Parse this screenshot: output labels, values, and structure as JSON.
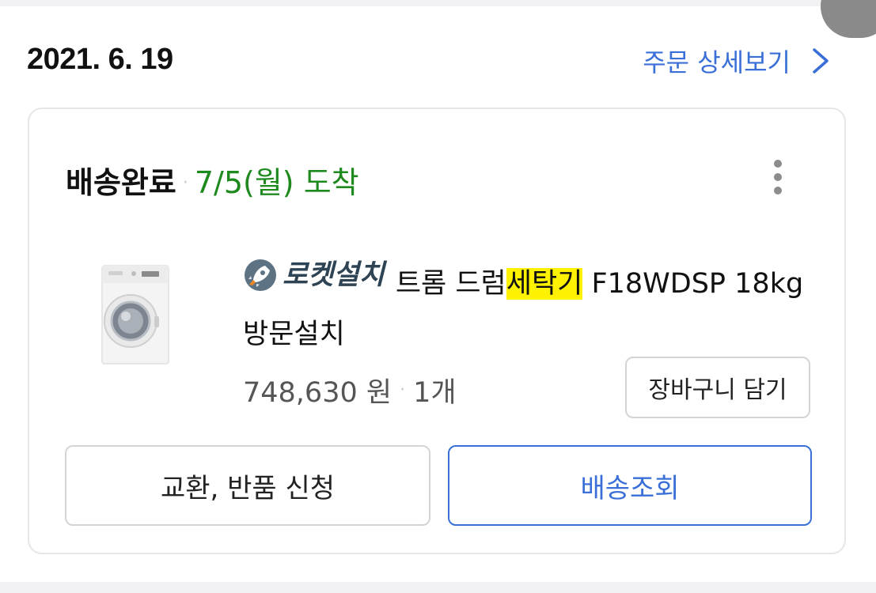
{
  "order": {
    "date": "2021. 6. 19",
    "detail_link": "주문 상세보기",
    "accent_color": "#3a6fd8"
  },
  "shipment": {
    "status": "배송완료",
    "separator": "·",
    "arrival": "7/5(월) 도착",
    "arrival_color": "#1e8a1e"
  },
  "product": {
    "badge": "로켓설치",
    "badge_icon": "rocket-icon",
    "title_before": "트롬 드럼",
    "title_highlight": "세탁기",
    "title_after": " F18WDSP 18kg 방문설치",
    "highlight_color": "#fff200",
    "price": "748,630 원",
    "separator": "·",
    "quantity": "1개",
    "image_icon": "washing-machine-image"
  },
  "actions": {
    "add_to_cart": "장바구니 담기",
    "return_exchange": "교환, 반품 신청",
    "track_delivery": "배송조회"
  },
  "menu_icon": "more-vertical-icon"
}
